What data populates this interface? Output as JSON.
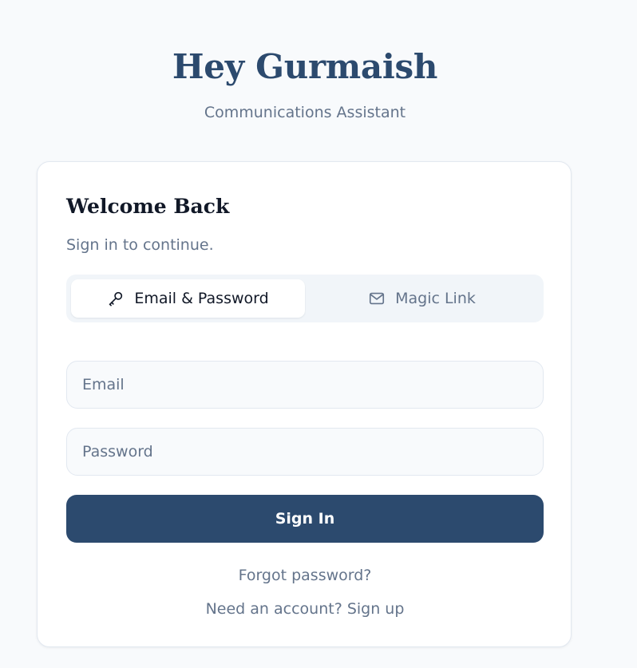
{
  "header": {
    "title": "Hey Gurmaish",
    "subtitle": "Communications Assistant"
  },
  "card": {
    "title": "Welcome Back",
    "subtitle": "Sign in to continue."
  },
  "tabs": [
    {
      "label": "Email & Password",
      "icon": "key-icon",
      "active": true
    },
    {
      "label": "Magic Link",
      "icon": "mail-icon",
      "active": false
    }
  ],
  "form": {
    "email_placeholder": "Email",
    "password_placeholder": "Password",
    "submit_label": "Sign In"
  },
  "links": {
    "forgot_password": "Forgot password?",
    "need_account_prefix": "Need an account?",
    "sign_up": "Sign up"
  },
  "colors": {
    "brand": "#2c4a6e",
    "background": "#f8fafc",
    "muted_text": "#64748b"
  }
}
